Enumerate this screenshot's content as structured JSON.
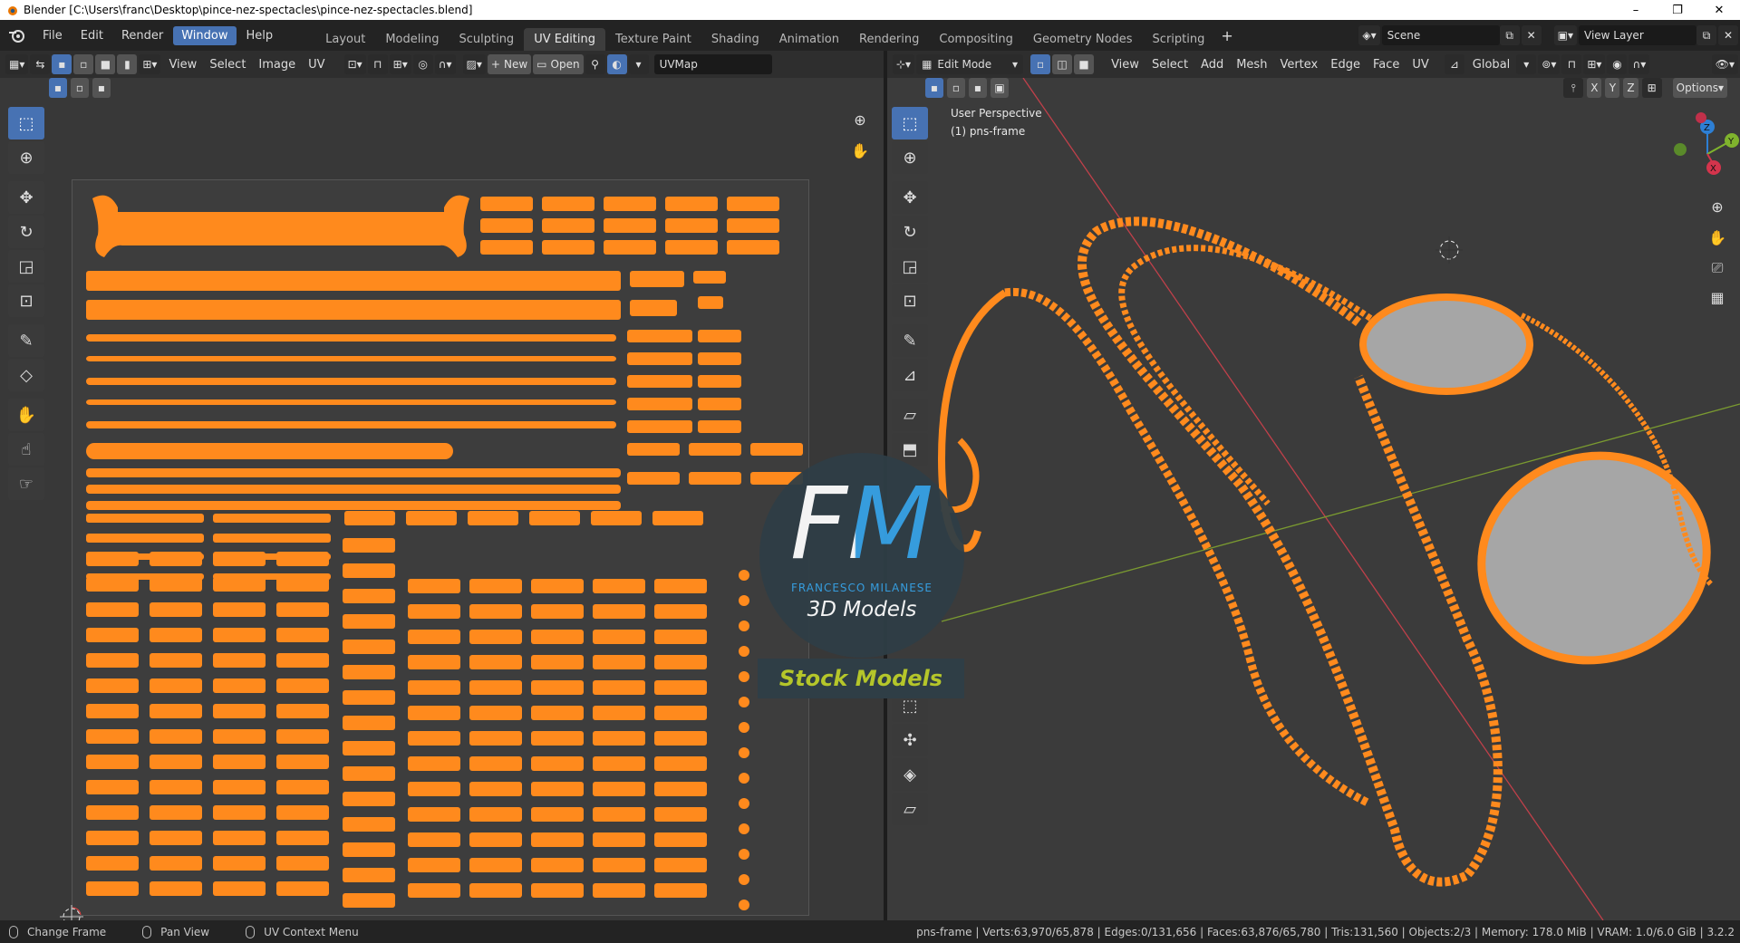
{
  "window": {
    "title": "Blender [C:\\Users\\franc\\Desktop\\pince-nez-spectacles\\pince-nez-spectacles.blend]",
    "minimize": "–",
    "restore": "❐",
    "close": "✕"
  },
  "menu": [
    "File",
    "Edit",
    "Render",
    "Window",
    "Help"
  ],
  "menu_active_index": 3,
  "workspaces": [
    "Layout",
    "Modeling",
    "Sculpting",
    "UV Editing",
    "Texture Paint",
    "Shading",
    "Animation",
    "Rendering",
    "Compositing",
    "Geometry Nodes",
    "Scripting"
  ],
  "workspace_active": "UV Editing",
  "add_workspace": "+",
  "scene": {
    "label": "Scene",
    "view_layer": "View Layer"
  },
  "uv_editor": {
    "menus": [
      "View",
      "Select",
      "Image",
      "UV"
    ],
    "new_label": "New",
    "open_label": "Open",
    "uvmap": "UVMap"
  },
  "viewport": {
    "mode": "Edit Mode",
    "menus": [
      "View",
      "Select",
      "Add",
      "Mesh",
      "Vertex",
      "Edge",
      "Face",
      "UV"
    ],
    "orientation": "Global",
    "options": "Options",
    "axis_x": "X",
    "axis_y": "Y",
    "axis_z": "Z",
    "perspective": "User Perspective",
    "object": "(1) pns-frame"
  },
  "watermark": {
    "letters": "FM",
    "name": "FRANCESCO MILANESE",
    "subtitle": "3D Models",
    "banner": "Stock Models"
  },
  "statusbar": {
    "left": [
      "Change Frame",
      "Pan View",
      "UV Context Menu"
    ],
    "stats": "pns-frame | Verts:63,970/65,878 | Edges:0/131,656 | Faces:63,876/65,780 | Tris:131,560 | Objects:2/3 | Memory: 178.0 MiB | VRAM: 1.0/6.0 GiB | 3.2.2"
  },
  "colors": {
    "accent": "#4772b3",
    "uv_orange": "#ff8a1d",
    "lens_gray": "#a6a6a6",
    "watermark_blue": "#36a3e8",
    "banner_text": "#b5c62a"
  }
}
